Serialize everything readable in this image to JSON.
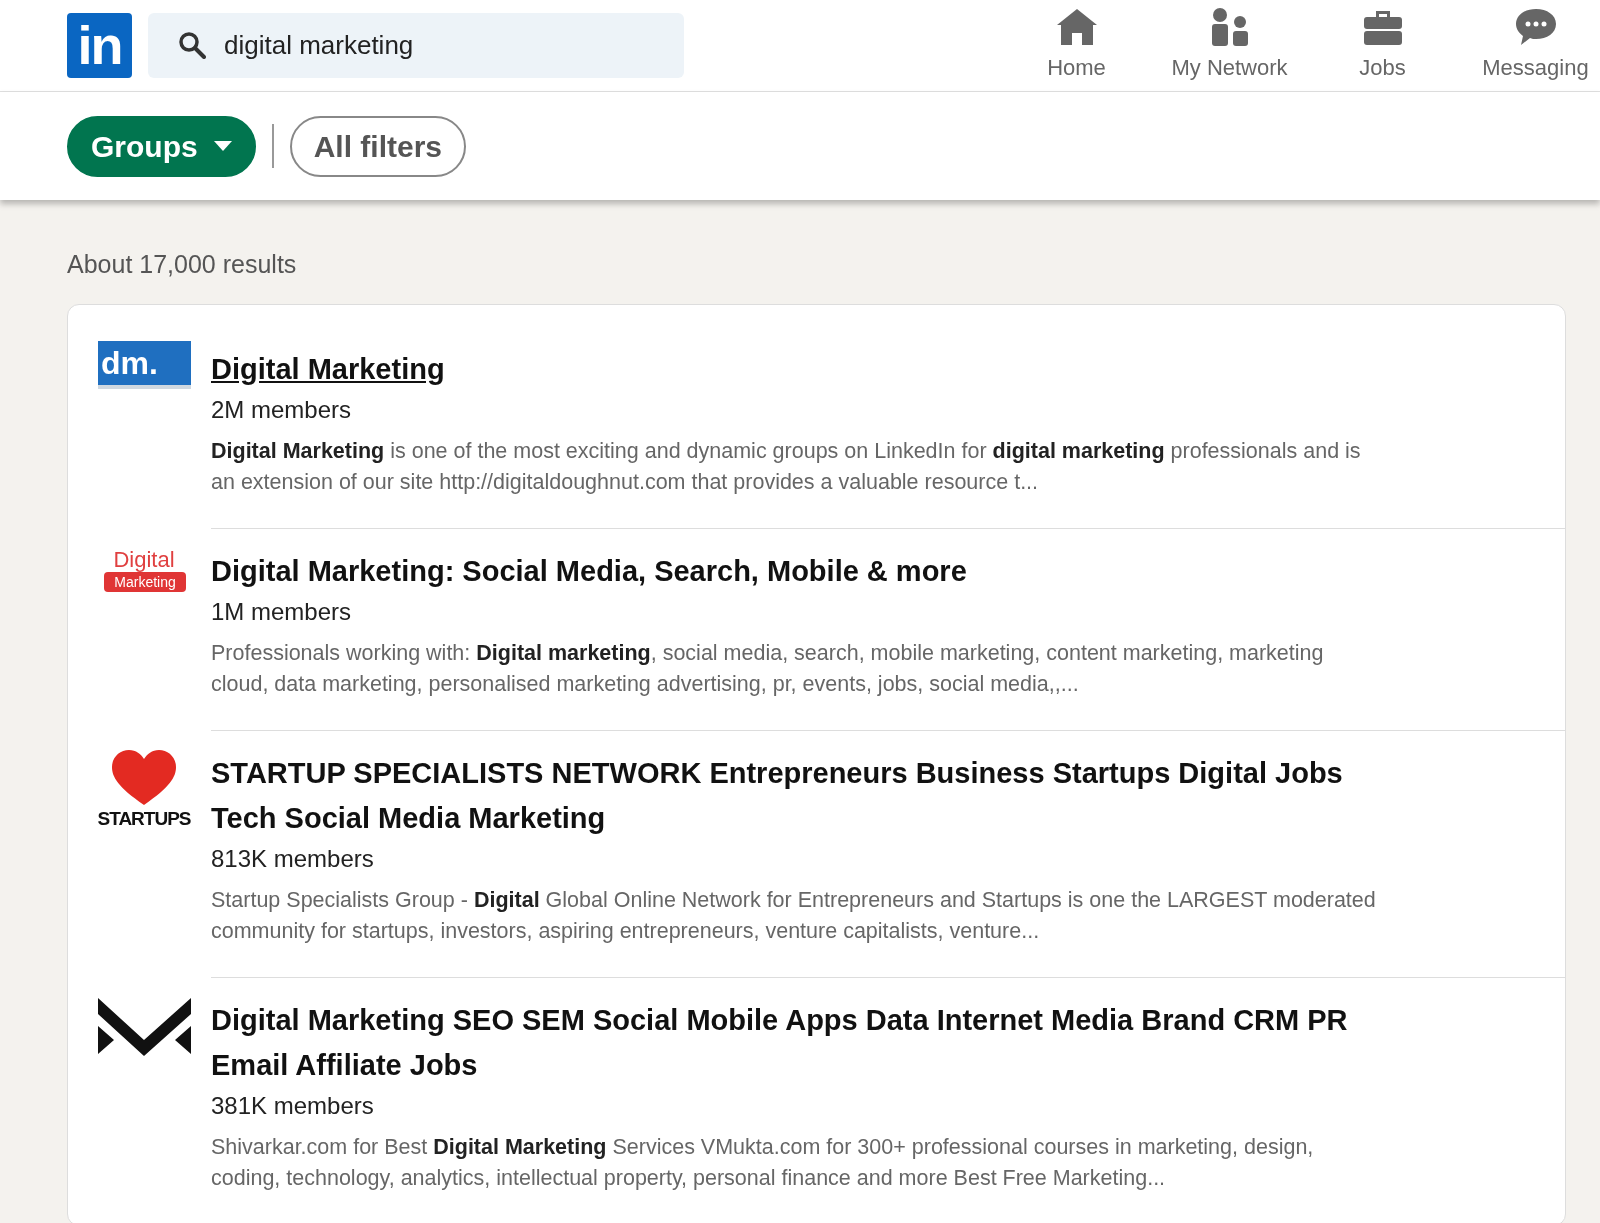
{
  "header": {
    "logo_text": "in",
    "search": {
      "value": "digital marketing"
    },
    "nav": [
      {
        "label": "Home",
        "kind": "home"
      },
      {
        "label": "My Network",
        "kind": "network"
      },
      {
        "label": "Jobs",
        "kind": "jobs"
      },
      {
        "label": "Messaging",
        "kind": "messaging"
      }
    ]
  },
  "filters": [
    {
      "label": "Groups",
      "selected": true,
      "dropdown": true
    },
    {
      "label": "All filters",
      "selected": false,
      "dropdown": false
    }
  ],
  "results_count": "About 17,000 results",
  "results": [
    {
      "title": "Digital Marketing",
      "hovered": true,
      "members": "2M members",
      "logo": {
        "kind": "dm",
        "text": "dm."
      },
      "description": "**Digital Marketing** is one of the most exciting and dynamic groups on LinkedIn for **digital marketing** professionals and is an extension of our site http://digitaldoughnut.com that provides a valuable resource t..."
    },
    {
      "title": "Digital Marketing: Social Media, Search, Mobile & more",
      "hovered": false,
      "members": "1M members",
      "logo": {
        "kind": "badge",
        "text": "Digital",
        "subtext": "Marketing"
      },
      "description": "Professionals working with: **Digital marketing**, social media, search, mobile marketing, content marketing, marketing cloud, data marketing, personalised marketing advertising, pr, events, jobs, social media,,..."
    },
    {
      "title": "STARTUP SPECIALISTS NETWORK Entrepreneurs Business Startups Digital Jobs Tech Social Media Marketing",
      "hovered": false,
      "members": "813K members",
      "logo": {
        "kind": "heart",
        "text": "STARTUPS"
      },
      "description": "Startup Specialists Group - **Digital** Global Online Network for Entrepreneurs and Startups is one the LARGEST moderated community for startups, investors, aspiring entrepreneurs, venture capitalists, venture..."
    },
    {
      "title": "Digital Marketing SEO SEM Social Mobile Apps Data Internet Media Brand CRM PR Email Affiliate Jobs",
      "hovered": false,
      "members": "381K members",
      "logo": {
        "kind": "chevrons"
      },
      "description": "Shivarkar.com for Best **Digital Marketing** Services VMukta.com for 300+ professional courses in marketing, design, coding, technology, analytics, intellectual property, personal finance and more Best Free Marketing..."
    }
  ]
}
